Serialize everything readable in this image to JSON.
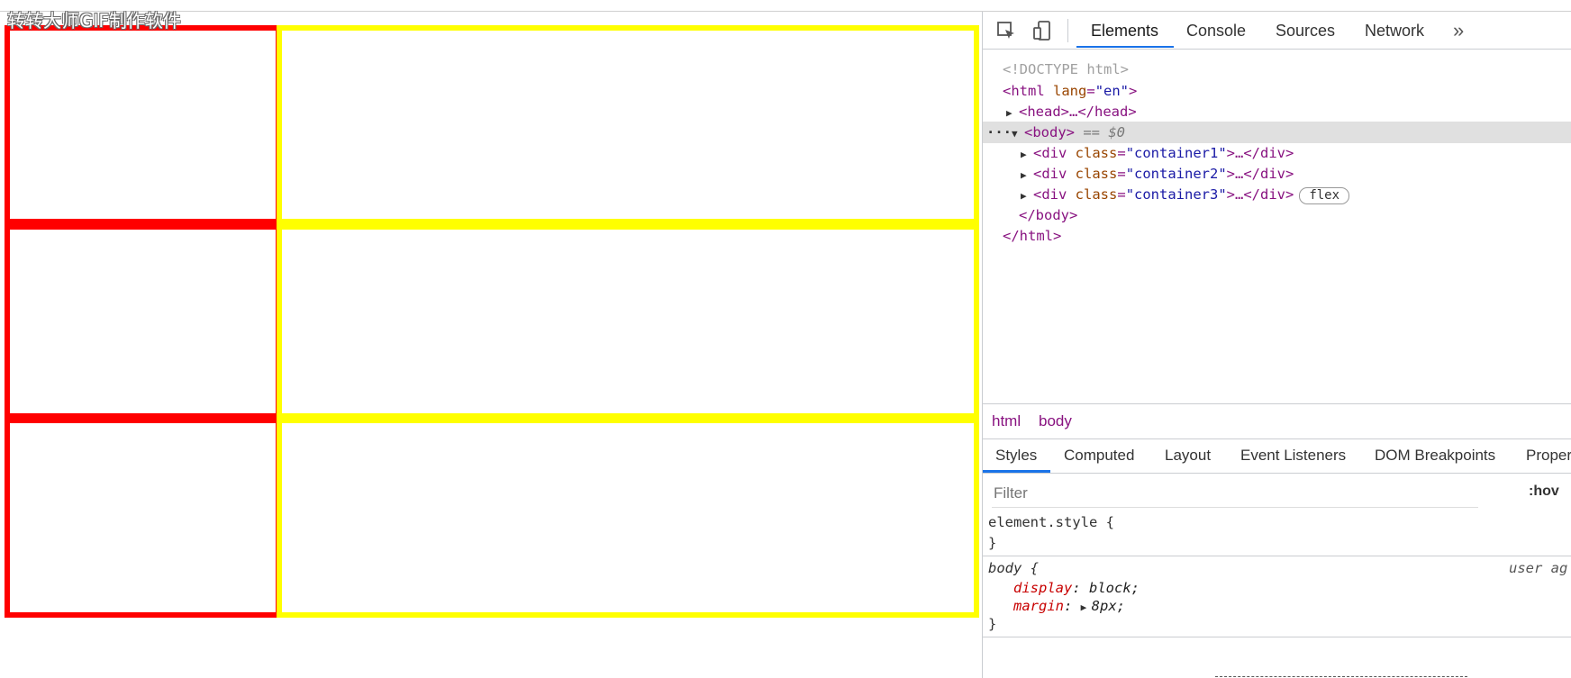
{
  "watermark": "转转大师GIF制作软件",
  "devtools": {
    "tabs": [
      "Elements",
      "Console",
      "Sources",
      "Network"
    ],
    "more_label": "»",
    "dom": {
      "doctype": "<!DOCTYPE html>",
      "html_open": "<html",
      "html_lang_attr": "lang",
      "html_lang_val": "\"en\"",
      "head": "<head>…</head>",
      "body_open": "<body>",
      "body_eq": "== $0",
      "div_tag": "<div",
      "class_attr": "class",
      "container1": "\"container1\"",
      "container2": "\"container2\"",
      "container3": "\"container3\"",
      "div_close": ">…</div>",
      "flex_badge": "flex",
      "body_close": "</body>",
      "html_close": "</html>"
    },
    "breadcrumb": [
      "html",
      "body"
    ],
    "style_tabs": [
      "Styles",
      "Computed",
      "Layout",
      "Event Listeners",
      "DOM Breakpoints",
      "Proper"
    ],
    "filter_placeholder": "Filter",
    "hov_label": ":hov",
    "rules": {
      "element_style": "element.style {",
      "close_brace": "}",
      "body_selector": "body {",
      "user_agent": "user ag",
      "display_prop": "display",
      "display_val": "block;",
      "margin_prop": "margin",
      "margin_val": "8px;"
    }
  }
}
